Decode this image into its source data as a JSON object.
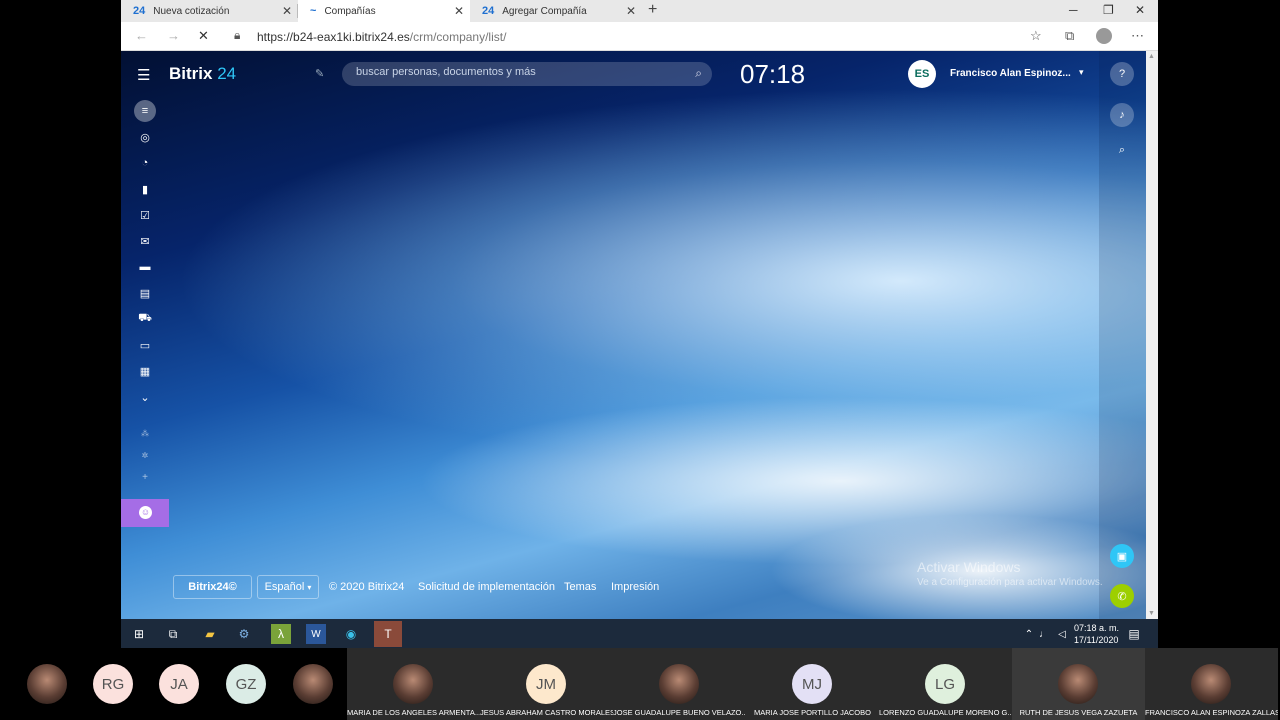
{
  "browser": {
    "tabs": [
      {
        "icon": "24",
        "label": "Nueva cotización"
      },
      {
        "icon": "~",
        "label": "Compañías"
      },
      {
        "icon": "24",
        "label": "Agregar Compañía"
      }
    ],
    "new_tab": "+",
    "url_host": "https://b24-eax1ki.bitrix24.es",
    "url_path": "/crm/company/list/"
  },
  "bitrix": {
    "logo_text": "Bitrix",
    "logo_num": "24",
    "search_placeholder": "buscar personas, documentos y más",
    "clock": "07:18",
    "avatar_initials": "ES",
    "user_name": "Francisco Alan Espinoz..."
  },
  "footer": {
    "brand_button": "Bitrix24©",
    "language": "Español",
    "copyright": "© 2020 Bitrix24",
    "links": [
      "Solicitud de implementación",
      "Temas",
      "Impresión"
    ]
  },
  "watermark": {
    "title": "Activar Windows",
    "subtitle": "Ve a Configuración para activar Windows."
  },
  "taskbar": {
    "time": "07:18 a. m.",
    "date": "17/11/2020"
  },
  "participants": [
    {
      "initials": "",
      "name": "",
      "bg": "#333333"
    },
    {
      "initials": "RG",
      "name": "",
      "bg": "#fbe1dd"
    },
    {
      "initials": "JA",
      "name": "",
      "bg": "#fbe1dd"
    },
    {
      "initials": "GZ",
      "name": "",
      "bg": "#dbece6"
    },
    {
      "initials": "",
      "name": "",
      "bg": "#333333"
    },
    {
      "initials": "",
      "name": "MARIA DE LOS ANGELES ARMENTA...",
      "bg": "#333333"
    },
    {
      "initials": "JM",
      "name": "JESUS ABRAHAM CASTRO MORALES",
      "bg": "#fde8cc"
    },
    {
      "initials": "",
      "name": "JOSE GUADALUPE BUENO VELAZO...",
      "bg": "#333333"
    },
    {
      "initials": "MJ",
      "name": "MARIA JOSE PORTILLO JACOBO",
      "bg": "#e3e0f5"
    },
    {
      "initials": "LG",
      "name": "LORENZO GUADALUPE MORENO G...",
      "bg": "#dff0dd"
    },
    {
      "initials": "",
      "name": "RUTH DE JESUS VEGA ZAZUETA",
      "bg": "#333333"
    },
    {
      "initials": "",
      "name": "FRANCISCO ALAN ESPINOZA ZALLAS",
      "bg": "#333333"
    }
  ]
}
